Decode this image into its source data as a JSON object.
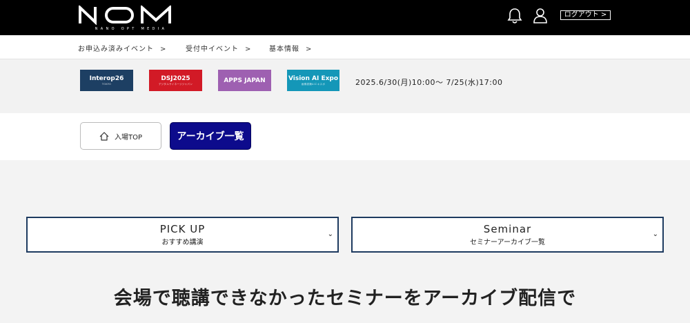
{
  "header": {
    "logo_text": "NOM",
    "logo_tagline": "NANO OPT MEDIA",
    "logout_label": "ログアウト >",
    "icons": [
      "bell-icon",
      "user-icon"
    ]
  },
  "breadcrumbs": [
    {
      "label": "お申込み済みイベント",
      "sep": ">"
    },
    {
      "label": "受付中イベント",
      "sep": ">"
    },
    {
      "label": "基本情報",
      "sep": ">"
    }
  ],
  "events": [
    {
      "name": "Interop26",
      "sub": "TOKYO",
      "color": "#1d3f63"
    },
    {
      "name": "DSJ2025",
      "sub": "デジタルサイネージジャパン",
      "color": "#d21a26"
    },
    {
      "name": "APPS JAPAN",
      "sub": "",
      "color": "#9e60b1"
    },
    {
      "name": "Vision AI Expo",
      "sub": "画像認識AIエキスポ",
      "color": "#1497b8"
    }
  ],
  "event_period": "2025.6/30(月)10:00〜 7/25(水)17:00",
  "nav": {
    "top_label": "入場TOP",
    "archive_label": "アーカイブ一覧"
  },
  "dropdowns": [
    {
      "title": "PICK UP",
      "subtitle": "おすすめ講演",
      "chevron": "⌄"
    },
    {
      "title": "Seminar",
      "subtitle": "セミナーアーカイブ一覧",
      "chevron": "⌄"
    }
  ],
  "headline": "会場で聴講できなかったセミナーをアーカイブ配信で",
  "colors": {
    "header_bg": "#000000",
    "archive_button": "#0d0b8c",
    "dropdown_border": "#1d3a5f"
  }
}
